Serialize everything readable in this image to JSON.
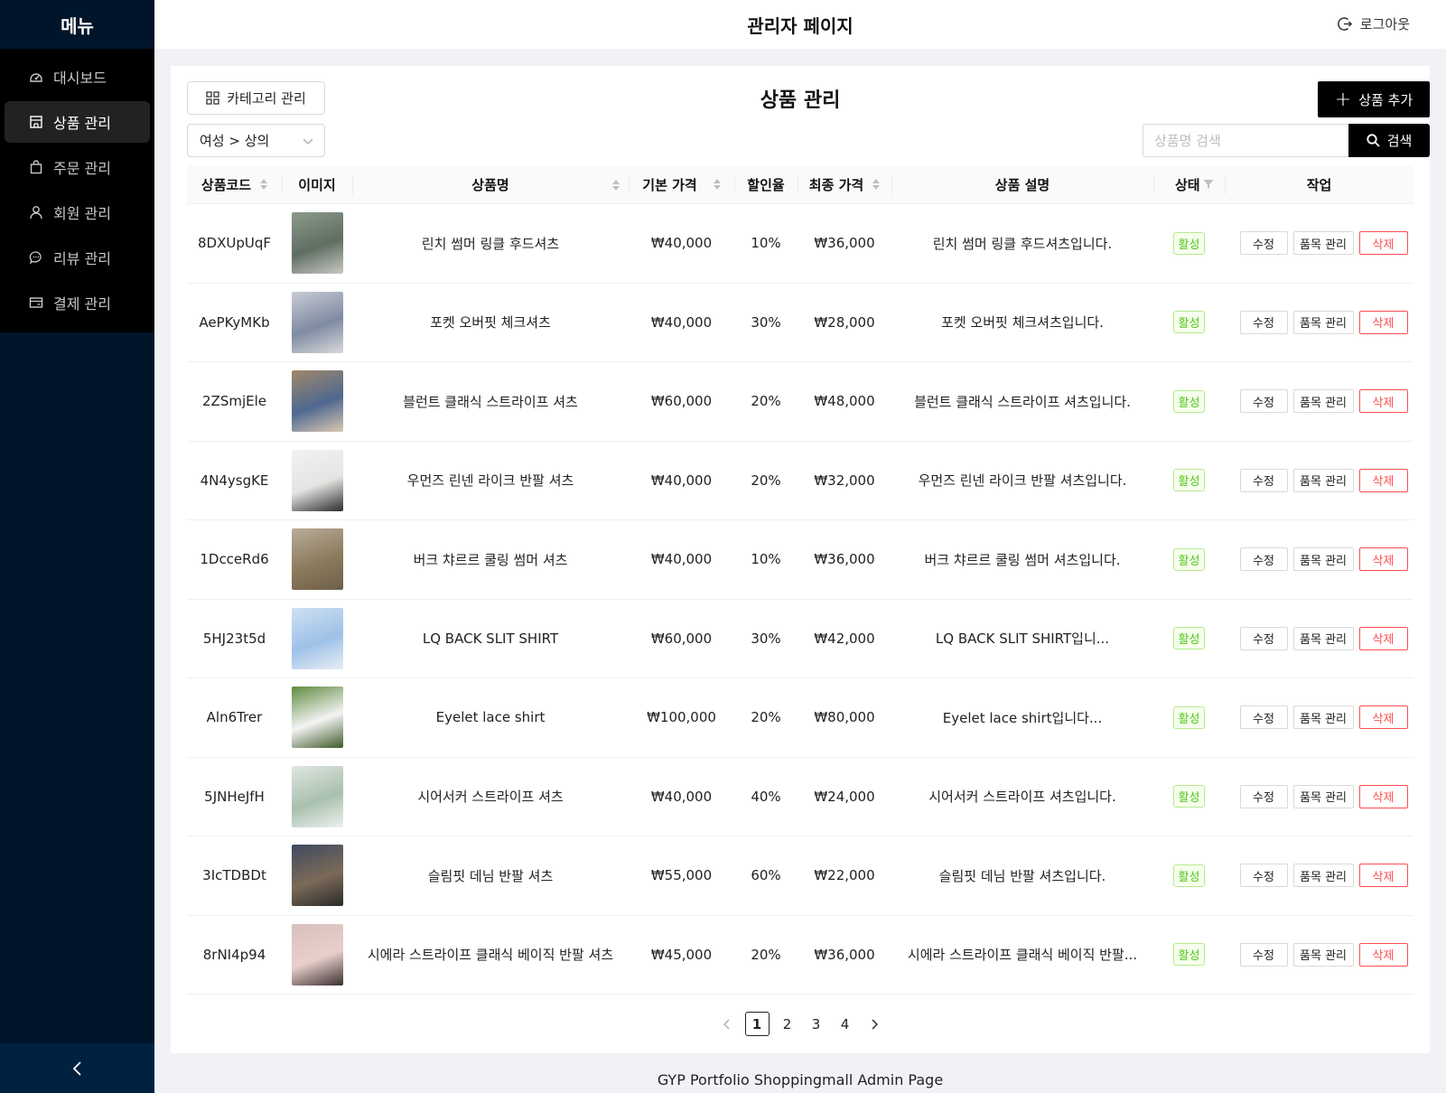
{
  "sidebar": {
    "title": "메뉴",
    "items": [
      {
        "label": "대시보드",
        "icon": "dashboard-icon",
        "active": false
      },
      {
        "label": "상품 관리",
        "icon": "shop-icon",
        "active": true
      },
      {
        "label": "주문 관리",
        "icon": "shopping-bag-icon",
        "active": false
      },
      {
        "label": "회원 관리",
        "icon": "user-icon",
        "active": false
      },
      {
        "label": "리뷰 관리",
        "icon": "comment-icon",
        "active": false
      },
      {
        "label": "결제 관리",
        "icon": "credit-card-icon",
        "active": false
      }
    ],
    "collapse_icon": "chevron-left-icon"
  },
  "header": {
    "title": "관리자 페이지",
    "logout_label": "로그아웃"
  },
  "toolbar": {
    "category_button_label": "카테고리 관리",
    "category_select_value": "여성 > 상의",
    "page_title": "상품 관리",
    "add_button_label": "상품 추가",
    "search_placeholder": "상품명 검색",
    "search_button_label": "검색"
  },
  "table": {
    "columns": [
      "상품코드",
      "이미지",
      "상품명",
      "기본 가격",
      "할인율",
      "최종 가격",
      "상품 설명",
      "상태",
      "작업"
    ],
    "action_labels": {
      "edit": "수정",
      "stock": "품목 관리",
      "delete": "삭제"
    },
    "rows": [
      {
        "code": "8DXUpUqF",
        "name": "린치 썸머 링클 후드셔츠",
        "base_price": "₩40,000",
        "discount": "10%",
        "final_price": "₩36,000",
        "description": "린치 썸머 링클 후드셔츠입니다.",
        "status": "활성",
        "thumb_colors": [
          "#8a9a8a",
          "#5f6e62",
          "#c9c9c4"
        ]
      },
      {
        "code": "AePKyMKb",
        "name": "포켓 오버핏 체크셔츠",
        "base_price": "₩40,000",
        "discount": "30%",
        "final_price": "₩28,000",
        "description": "포켓 오버핏 체크셔츠입니다.",
        "status": "활성",
        "thumb_colors": [
          "#c8ccd4",
          "#7f8ba3",
          "#d9d9d9"
        ]
      },
      {
        "code": "2ZSmjEle",
        "name": "블런트 클래식 스트라이프 셔츠",
        "base_price": "₩60,000",
        "discount": "20%",
        "final_price": "₩48,000",
        "description": "블런트 클래식 스트라이프 셔츠입니다.",
        "status": "활성",
        "thumb_colors": [
          "#a0886a",
          "#4f6890",
          "#d8c8b0"
        ]
      },
      {
        "code": "4N4ysgKE",
        "name": "우먼즈 린넨 라이크 반팔 셔츠",
        "base_price": "₩40,000",
        "discount": "20%",
        "final_price": "₩32,000",
        "description": "우먼즈 린넨 라이크 반팔 셔츠입니다.",
        "status": "활성",
        "thumb_colors": [
          "#f2f2f0",
          "#e4e4e2",
          "#2c2c2c"
        ]
      },
      {
        "code": "1DcceRd6",
        "name": "버크 챠르르 쿨링 썸머 셔츠",
        "base_price": "₩40,000",
        "discount": "10%",
        "final_price": "₩36,000",
        "description": "버크 챠르르 쿨링 썸머 셔츠입니다.",
        "status": "활성",
        "thumb_colors": [
          "#b8ad9a",
          "#8c7a5c",
          "#6e5f48"
        ]
      },
      {
        "code": "5HJ23t5d",
        "name": "LQ BACK SLIT SHIRT",
        "base_price": "₩60,000",
        "discount": "30%",
        "final_price": "₩42,000",
        "description": "LQ BACK SLIT SHIRT입니...",
        "status": "활성",
        "thumb_colors": [
          "#cfe0f2",
          "#9ec1e8",
          "#e8eef4"
        ]
      },
      {
        "code": "Aln6Trer",
        "name": "Eyelet lace shirt",
        "base_price": "₩100,000",
        "discount": "20%",
        "final_price": "₩80,000",
        "description": "Eyelet lace shirt입니다...",
        "status": "활성",
        "thumb_colors": [
          "#5e8a3e",
          "#f4f4f4",
          "#3d5a28"
        ]
      },
      {
        "code": "5JNHeJfH",
        "name": "시어서커 스트라이프 셔츠",
        "base_price": "₩40,000",
        "discount": "40%",
        "final_price": "₩24,000",
        "description": "시어서커 스트라이프 셔츠입니다.",
        "status": "활성",
        "thumb_colors": [
          "#dfe6e0",
          "#a9c0ae",
          "#eef0ee"
        ]
      },
      {
        "code": "3IcTDBDt",
        "name": "슬림핏 데님 반팔 셔츠",
        "base_price": "₩55,000",
        "discount": "60%",
        "final_price": "₩22,000",
        "description": "슬림핏 데님 반팔 셔츠입니다.",
        "status": "활성",
        "thumb_colors": [
          "#3e4a60",
          "#7c6a58",
          "#2a2a2a"
        ]
      },
      {
        "code": "8rNI4p94",
        "name": "시에라 스트라이프 클래식 베이직 반팔 셔츠",
        "base_price": "₩45,000",
        "discount": "20%",
        "final_price": "₩36,000",
        "description": "시에라 스트라이프 클래식 베이직 반팔...",
        "status": "활성",
        "thumb_colors": [
          "#d8c0bc",
          "#e8cfcc",
          "#3a3030"
        ]
      }
    ]
  },
  "pagination": {
    "pages": [
      "1",
      "2",
      "3",
      "4"
    ],
    "current": "1"
  },
  "footer": {
    "text": "GYP Portfolio Shoppingmall Admin Page"
  }
}
